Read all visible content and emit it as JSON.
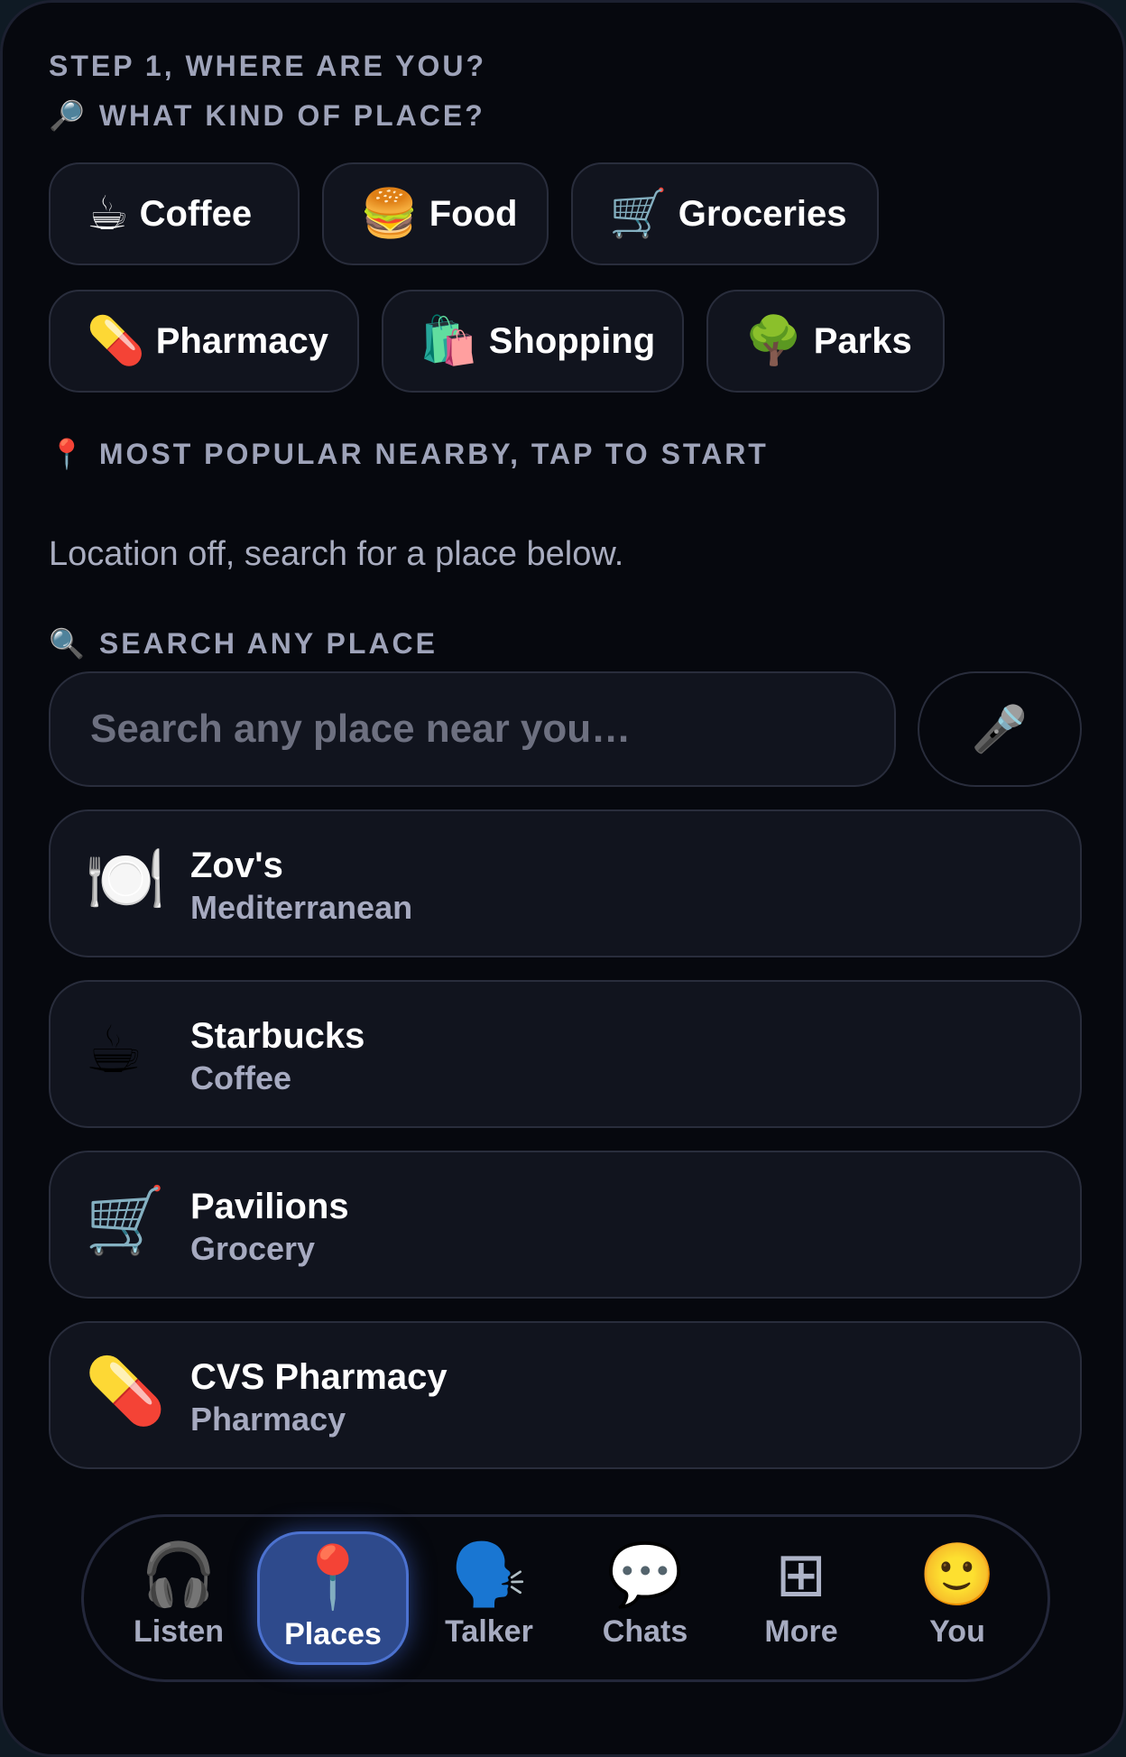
{
  "labels": {
    "step": "STEP 1, WHERE ARE YOU?",
    "kind": "WHAT KIND OF PLACE?",
    "popular": "MOST POPULAR NEARBY, TAP TO START",
    "search": "SEARCH ANY PLACE"
  },
  "icons": {
    "kind": "🔎",
    "popular": "📍",
    "search": "🔍",
    "mic": "🎤"
  },
  "categories": [
    {
      "emoji": "☕",
      "label": "Coffee"
    },
    {
      "emoji": "🍔",
      "label": "Food"
    },
    {
      "emoji": "🛒",
      "label": "Groceries"
    },
    {
      "emoji": "💊",
      "label": "Pharmacy"
    },
    {
      "emoji": "🛍️",
      "label": "Shopping"
    },
    {
      "emoji": "🌳",
      "label": "Parks"
    }
  ],
  "location_hint": "Location off, search for a place below.",
  "search": {
    "placeholder": "Search any place near you…",
    "value": ""
  },
  "places": [
    {
      "emoji": "🍽️",
      "name": "Zov's",
      "type": "Mediterranean"
    },
    {
      "emoji": "☕",
      "name": "Starbucks",
      "type": "Coffee"
    },
    {
      "emoji": "🛒",
      "name": "Pavilions",
      "type": "Grocery"
    },
    {
      "emoji": "💊",
      "name": "CVS Pharmacy",
      "type": "Pharmacy"
    }
  ],
  "nav": {
    "active": "Places",
    "items": [
      {
        "icon": "🎧",
        "label": "Listen"
      },
      {
        "icon": "📍",
        "label": "Places"
      },
      {
        "icon": "🗣️",
        "label": "Talker"
      },
      {
        "icon": "💬",
        "label": "Chats"
      },
      {
        "icon": "⊞",
        "label": "More"
      },
      {
        "icon": "🙂",
        "label": "You"
      }
    ]
  },
  "colors": {
    "background": "#06080e",
    "card": "#11141e",
    "active_tab": "#2e4a8c",
    "label": "#9ea3b9"
  }
}
